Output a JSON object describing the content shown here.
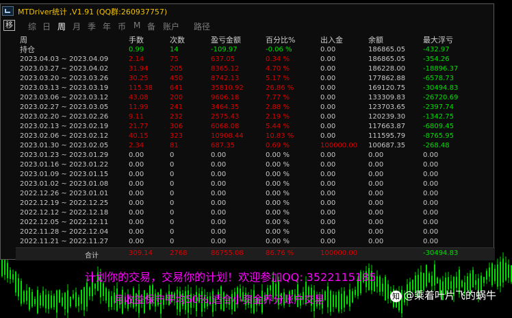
{
  "window": {
    "title": "MTDriver统计 ,V1.91 (QQ群:260937757)"
  },
  "nav": {
    "button": "移",
    "tabs": [
      "综",
      "日",
      "周",
      "月",
      "季",
      "年",
      "币",
      "M",
      "备",
      "账户",
      "路径"
    ],
    "active": "周"
  },
  "headers": [
    "周",
    "手数",
    "次数",
    "盈亏金额",
    "百分比%",
    "出入金",
    "余额",
    "最大浮亏"
  ],
  "holding": {
    "label": "持仓",
    "lots": "0.99",
    "trades": "14",
    "pnl": "-109.97",
    "pct": "-0.06 %",
    "deposit": "0.00",
    "balance": "186865.05",
    "maxdd": "-432.97"
  },
  "rows": [
    {
      "period": "2023.04.03 ~ 2023.04.09",
      "lots": "2.14",
      "trades": "75",
      "pnl": "637.05",
      "pct": "0.34 %",
      "deposit": "0.00",
      "balance": "186865.05",
      "maxdd": "-354.26"
    },
    {
      "period": "2023.03.27 ~ 2023.04.02",
      "lots": "31.94",
      "trades": "205",
      "pnl": "8365.12",
      "pct": "4.70 %",
      "deposit": "0.00",
      "balance": "186228.00",
      "maxdd": "-18896.37"
    },
    {
      "period": "2023.03.20 ~ 2023.03.26",
      "lots": "30.25",
      "trades": "450",
      "pnl": "8742.13",
      "pct": "5.17 %",
      "deposit": "0.00",
      "balance": "177862.88",
      "maxdd": "-6578.73"
    },
    {
      "period": "2023.03.13 ~ 2023.03.19",
      "lots": "115.38",
      "trades": "641",
      "pnl": "35810.92",
      "pct": "26.86 %",
      "deposit": "0.00",
      "balance": "169120.75",
      "maxdd": "-30494.83"
    },
    {
      "period": "2023.03.06 ~ 2023.03.12",
      "lots": "43.08",
      "trades": "200",
      "pnl": "9606.18",
      "pct": "7.77 %",
      "deposit": "0.00",
      "balance": "133309.83",
      "maxdd": "-26720.69"
    },
    {
      "period": "2023.02.27 ~ 2023.03.05",
      "lots": "11.99",
      "trades": "241",
      "pnl": "3464.35",
      "pct": "2.88 %",
      "deposit": "0.00",
      "balance": "123703.65",
      "maxdd": "-2397.74"
    },
    {
      "period": "2023.02.20 ~ 2023.02.26",
      "lots": "9.11",
      "trades": "232",
      "pnl": "2575.43",
      "pct": "2.19 %",
      "deposit": "0.00",
      "balance": "120239.30",
      "maxdd": "-1342.75"
    },
    {
      "period": "2023.02.13 ~ 2023.02.19",
      "lots": "21.77",
      "trades": "306",
      "pnl": "6068.08",
      "pct": "5.44 %",
      "deposit": "0.00",
      "balance": "117663.87",
      "maxdd": "-6809.45"
    },
    {
      "period": "2023.02.06 ~ 2023.02.12",
      "lots": "40.15",
      "trades": "323",
      "pnl": "10908.44",
      "pct": "10.83 %",
      "deposit": "0.00",
      "balance": "111595.79",
      "maxdd": "-8765.95"
    },
    {
      "period": "2023.01.30 ~ 2023.02.05",
      "lots": "2.34",
      "trades": "81",
      "pnl": "687.35",
      "pct": "0.69 %",
      "deposit": "100000.00",
      "balance": "100687.35",
      "maxdd": "-268.48"
    },
    {
      "period": "2023.01.23 ~ 2023.01.29",
      "lots": "0.00",
      "trades": "0",
      "pnl": "0.00",
      "pct": "0.00 %",
      "deposit": "0.00",
      "balance": "0.00",
      "maxdd": "0.00"
    },
    {
      "period": "2023.01.16 ~ 2023.01.22",
      "lots": "0.00",
      "trades": "0",
      "pnl": "0.00",
      "pct": "0.00 %",
      "deposit": "0.00",
      "balance": "0.00",
      "maxdd": "0.00"
    },
    {
      "period": "2023.01.09 ~ 2023.01.15",
      "lots": "0.00",
      "trades": "0",
      "pnl": "0.00",
      "pct": "0.00 %",
      "deposit": "0.00",
      "balance": "0.00",
      "maxdd": "0.00"
    },
    {
      "period": "2023.01.02 ~ 2023.01.08",
      "lots": "0.00",
      "trades": "0",
      "pnl": "0.00",
      "pct": "0.00 %",
      "deposit": "0.00",
      "balance": "0.00",
      "maxdd": "0.00"
    },
    {
      "period": "2022.12.26 ~ 2023.01.01",
      "lots": "0.00",
      "trades": "0",
      "pnl": "0.00",
      "pct": "0.00 %",
      "deposit": "0.00",
      "balance": "0.00",
      "maxdd": "0.00"
    },
    {
      "period": "2022.12.19 ~ 2022.12.25",
      "lots": "0.00",
      "trades": "0",
      "pnl": "0.00",
      "pct": "0.00 %",
      "deposit": "0.00",
      "balance": "0.00",
      "maxdd": "0.00"
    },
    {
      "period": "2022.12.12 ~ 2022.12.18",
      "lots": "0.00",
      "trades": "0",
      "pnl": "0.00",
      "pct": "0.00 %",
      "deposit": "0.00",
      "balance": "0.00",
      "maxdd": "0.00"
    },
    {
      "period": "2022.12.05 ~ 2022.12.11",
      "lots": "0.00",
      "trades": "0",
      "pnl": "0.00",
      "pct": "0.00 %",
      "deposit": "0.00",
      "balance": "0.00",
      "maxdd": "0.00"
    },
    {
      "period": "2022.11.28 ~ 2022.12.04",
      "lots": "0.00",
      "trades": "0",
      "pnl": "0.00",
      "pct": "0.00 %",
      "deposit": "0.00",
      "balance": "0.00",
      "maxdd": "0.00"
    },
    {
      "period": "2022.11.21 ~ 2022.11.27",
      "lots": "0.00",
      "trades": "0",
      "pnl": "0.00",
      "pct": "0.00 %",
      "deposit": "0.00",
      "balance": "0.00",
      "maxdd": "0.00"
    }
  ],
  "total": {
    "label": "合计",
    "lots": "309.14",
    "trades": "2768",
    "pnl": "86755.08",
    "pct": "86.76 %",
    "deposit": "100000.00",
    "maxdd": "-30494.83"
  },
  "ad": {
    "line1": "计划你的交易，交易你的计划！欢迎参加QQ: 3522115185",
    "line2": "月收益保守平均50%,适合小资金养分账户交易"
  },
  "watermark": {
    "text": "@乘着叶片飞的蜗牛",
    "icon": "zhihu-logo-icon"
  },
  "colors": {
    "profit": "#e00000",
    "neutral": "#c8c8c8",
    "holding": "#00e000",
    "drawdown": "#00e000",
    "title": "#f2c200",
    "ad": "#ff00ff",
    "candle": "#00e000"
  }
}
